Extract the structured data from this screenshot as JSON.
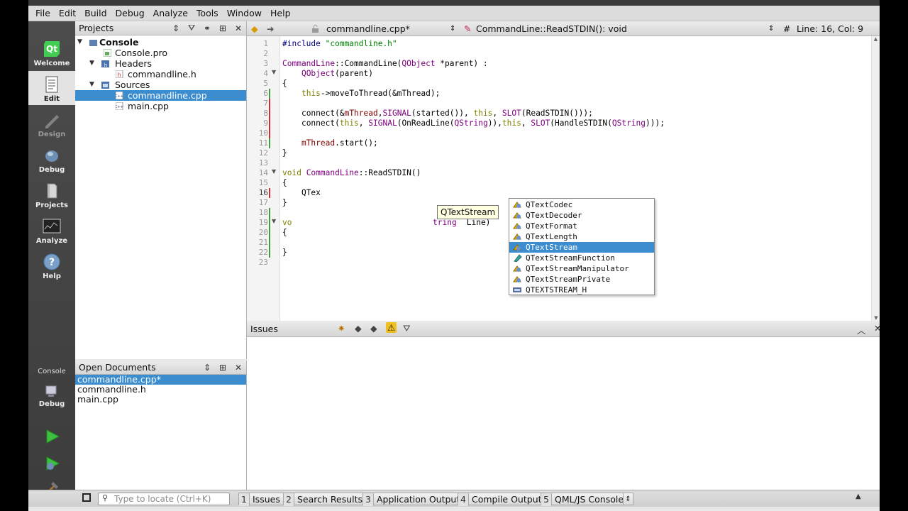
{
  "menu": [
    "File",
    "Edit",
    "Build",
    "Debug",
    "Analyze",
    "Tools",
    "Window",
    "Help"
  ],
  "modes": {
    "welcome": "Welcome",
    "edit": "Edit",
    "design": "Design",
    "debug": "Debug",
    "projects": "Projects",
    "analyze": "Analyze",
    "help": "Help",
    "target_project": "Console",
    "target_config": "Debug"
  },
  "projects_panel": {
    "title": "Projects",
    "tree": {
      "root": "Console",
      "pro_file": "Console.pro",
      "headers": "Headers",
      "header_file": "commandline.h",
      "sources": "Sources",
      "source_file_1": "commandline.cpp",
      "source_file_2": "main.cpp"
    }
  },
  "open_documents": {
    "title": "Open Documents",
    "items": [
      "commandline.cpp*",
      "commandline.h",
      "main.cpp"
    ]
  },
  "editor_toolbar": {
    "file": "commandline.cpp*",
    "symbol": "CommandLine::ReadSTDIN(): void",
    "hash": "#",
    "position": "Line: 16, Col: 9"
  },
  "code": {
    "line_numbers": [
      "1",
      "2",
      "3",
      "4",
      "5",
      "6",
      "7",
      "8",
      "9",
      "10",
      "11",
      "12",
      "13",
      "14",
      "15",
      "16",
      "17",
      "18",
      "19",
      "20",
      "21",
      "22",
      "23"
    ],
    "l1_kw": "#include ",
    "l1_str": "\"commandline.h\"",
    "l3_cls": "CommandLine",
    "l3_mid": "::CommandLine(",
    "l3_type": "QObject",
    "l3_end": " *parent) :",
    "l4_type": "QObject",
    "l4_end": "(parent)",
    "l5": "{",
    "l6_kw": "this",
    "l6_end": "->moveToThread(&mThread);",
    "l8_a": "connect(&",
    "l8_m": "mThread",
    "l8_b": ",",
    "l8_sig": "SIGNAL",
    "l8_c": "(started()), ",
    "l8_this": "this",
    "l8_d": ", ",
    "l8_slot": "SLOT",
    "l8_e": "(ReadSTDIN()));",
    "l9_a": "connect(",
    "l9_this": "this",
    "l9_b": ", ",
    "l9_sig": "SIGNAL",
    "l9_c": "(OnReadLine(",
    "l9_qs": "QString",
    "l9_d": ")),",
    "l9_this2": "this",
    "l9_e": ", ",
    "l9_slot": "SLOT",
    "l9_f": "(HandleSTDIN(",
    "l9_qs2": "QString",
    "l9_g": ")));",
    "l11_m": "mThread",
    "l11_end": ".start();",
    "l12": "}",
    "l14_kw": "void ",
    "l14_cls": "CommandLine",
    "l14_end": "::ReadSTDIN()",
    "l15": "{",
    "l16": "QTex",
    "l17": "}",
    "l19_a": "vo",
    "l19_b": "tring",
    "l19_c": " Line)",
    "l20": "{",
    "l22": "}"
  },
  "completion": {
    "items": [
      "QTextCodec",
      "QTextDecoder",
      "QTextFormat",
      "QTextLength",
      "QTextStream",
      "QTextStreamFunction",
      "QTextStreamManipulator",
      "QTextStreamPrivate",
      "QTEXTSTREAM_H"
    ],
    "selected": "QTextStream",
    "tooltip": "QTextStream"
  },
  "issues_panel": {
    "title": "Issues"
  },
  "statusbar": {
    "locator_placeholder": "Type to locate (Ctrl+K)",
    "tabs": [
      {
        "num": "1",
        "label": "Issues"
      },
      {
        "num": "2",
        "label": "Search Results"
      },
      {
        "num": "3",
        "label": "Application Output"
      },
      {
        "num": "4",
        "label": "Compile Output"
      },
      {
        "num": "5",
        "label": "QML/JS Console"
      }
    ]
  },
  "colors": {
    "selection": "#3b8dd0",
    "keyword": "#808000",
    "type": "#800080",
    "string": "#008000",
    "member": "#800000",
    "changed_marker": "#d03030",
    "saved_marker": "#40a040"
  }
}
